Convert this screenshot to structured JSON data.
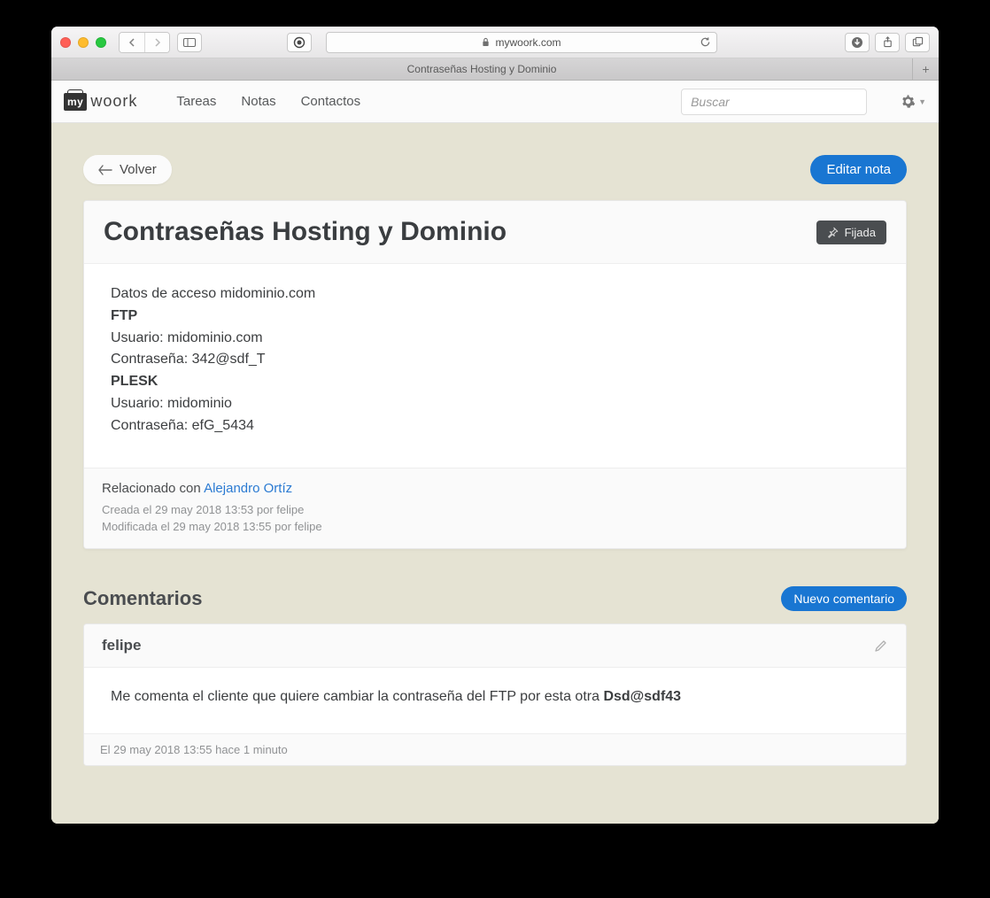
{
  "browser": {
    "url_display": "mywoork.com",
    "tab_title": "Contraseñas Hosting y Dominio"
  },
  "header": {
    "logo_prefix": "my",
    "logo_suffix": "woork",
    "nav": {
      "tareas": "Tareas",
      "notas": "Notas",
      "contactos": "Contactos"
    },
    "search_placeholder": "Buscar"
  },
  "toolbar": {
    "back_label": "Volver",
    "edit_label": "Editar nota"
  },
  "note": {
    "title": "Contraseñas Hosting y Dominio",
    "pinned_label": "Fijada",
    "body": {
      "line1": "Datos de acceso midominio.com",
      "ftp_hdr": "FTP",
      "ftp_user": "Usuario: midominio.com",
      "ftp_pass": "Contraseña: 342@sdf_T",
      "plesk_hdr": "PLESK",
      "plesk_user": "Usuario: midominio",
      "plesk_pass": "Contraseña: efG_5434"
    },
    "related_prefix": "Relacionado con ",
    "related_link": "Alejandro Ortíz",
    "created": "Creada el 29 may 2018 13:53 por felipe",
    "modified": "Modificada el 29 may 2018 13:55 por felipe"
  },
  "comments": {
    "heading": "Comentarios",
    "new_label": "Nuevo comentario",
    "items": [
      {
        "author": "felipe",
        "text_prefix": "Me comenta el cliente que quiere cambiar la contraseña del FTP por esta otra ",
        "text_strong": "Dsd@sdf43",
        "timestamp": "El 29 may 2018 13:55 hace 1 minuto"
      }
    ]
  }
}
